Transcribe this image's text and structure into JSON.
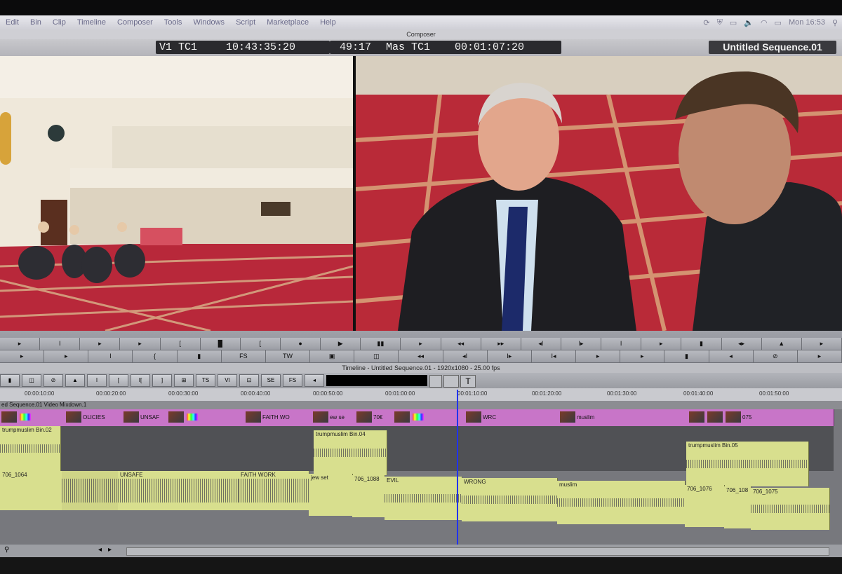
{
  "menu": {
    "items": [
      "Edit",
      "Bin",
      "Clip",
      "Timeline",
      "Composer",
      "Tools",
      "Windows",
      "Script",
      "Marketplace",
      "Help"
    ],
    "clock": "Mon 16:53"
  },
  "composer": {
    "title": "Composer",
    "src_track": "V1",
    "src_tc_label": "TC1",
    "src_tc": "10:43:35:20",
    "duration": "49:17",
    "rec_tc_label": "Mas TC1",
    "rec_tc": "00:01:07:20",
    "sequence_name": "Untitled Sequence.01"
  },
  "controls": {
    "row1": [
      "▸",
      "I",
      "▸",
      "▸",
      "[",
      "▐▌",
      "[",
      "●",
      "▶",
      "▮▮",
      "▸",
      "◂◂",
      "▸▸",
      "◂I",
      "I▸",
      "I",
      "▸",
      "▮",
      "◂▸",
      "▲",
      "▸"
    ],
    "row2": [
      "▸",
      "▸",
      "I",
      "{",
      "▮",
      "FS",
      "TW",
      "▣",
      "◫",
      "◂◂",
      "◂I",
      "I▸",
      "I◂",
      "▸",
      "▸",
      "▮",
      "◂",
      "⊘",
      "▸"
    ]
  },
  "timeline": {
    "title": "Timeline - Untitled Sequence.01 - 1920x1080 - 25.00 fps",
    "toolbar": [
      "▮",
      "◫",
      "⊘",
      "▲",
      "I",
      "[",
      "I[",
      "]",
      "⊞",
      "TS",
      "VI",
      "⊡",
      "SE",
      "FS",
      "◂"
    ],
    "ruler": [
      "00:00:10:00",
      "00:00:20:00",
      "00:00:30:00",
      "00:00:40:00",
      "00:00:50:00",
      "00:01:00:00",
      "00:01:10:00",
      "00:01:20:00",
      "00:01:30:00",
      "00:01:40:00",
      "00:01:50:00"
    ],
    "mixdown_label": "ed Sequence.01 Video Mixdown.1",
    "video_clips": [
      "OLICIES",
      "UNSAF",
      "FAITH WO",
      "ew se",
      "70€",
      "WRC",
      "muslim",
      "075"
    ],
    "a1_clips": [
      "trumpmuslim Bin.02",
      "trumpmuslim Bin.04",
      "trumpmuslim Bin.05"
    ],
    "a2_clips": [
      "706_1064",
      "UNSAFE",
      "FAITH WORK",
      "jew set",
      "706_1088",
      "EVIL",
      "WRONG",
      "muslim",
      "706_1076",
      "706_108",
      "706_1075"
    ]
  },
  "colors": {
    "video_track": "#c875c8",
    "audio_track": "#d8df8e",
    "playhead": "#2233ee"
  }
}
